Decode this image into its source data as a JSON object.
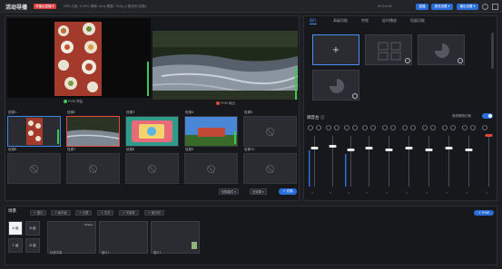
{
  "topbar": {
    "title": "活动导播",
    "live_badge": "导播台直播中",
    "stats": "CPU 占用: 9.19%   网络: 0ms   数据: 720p_4   推流中(切换)",
    "timer": "00:24:49",
    "btn_live": "直播",
    "btn_push": "推流设置 ▾",
    "btn_output": "输出设置 ▾"
  },
  "preview": {
    "pvw_label": "PVW 预监",
    "pgm_label": "PGM 输出"
  },
  "sources": [
    {
      "title": "信源1",
      "type": "food"
    },
    {
      "title": "信源2",
      "type": "river"
    },
    {
      "title": "信源3",
      "type": "colorful"
    },
    {
      "title": "信源4",
      "type": "building"
    },
    {
      "title": "信源5",
      "type": "empty"
    }
  ],
  "empty_sources": [
    "信源6",
    "信源7",
    "信源8",
    "信源9",
    "信源10"
  ],
  "controls": {
    "transition": "切换模式 ▾",
    "effect": "无效果 ▾",
    "take": "+ 切换"
  },
  "tabs": [
    "图片",
    "高级功能",
    "特效",
    "延时播放",
    "拓展功能"
  ],
  "fx_add": "+",
  "mixer": {
    "label": "调音台 ⓘ",
    "follow_label": "音频跟随切换",
    "channel_count": 10
  },
  "scenes": {
    "label": "场景",
    "tools": [
      "+ 图片",
      "+ 画中画",
      "+ 分屏",
      "+ 文字",
      "+ 字幕条",
      "+ 倒计时"
    ],
    "add_label": "+ PVW",
    "buttons": [
      "A 组",
      "B 组",
      "C 组",
      "D 组"
    ],
    "cards": [
      {
        "title": "Scene",
        "label": "标题字幕"
      },
      {
        "title": "",
        "label": "图片1"
      },
      {
        "title": "",
        "label": "图片1"
      }
    ]
  }
}
